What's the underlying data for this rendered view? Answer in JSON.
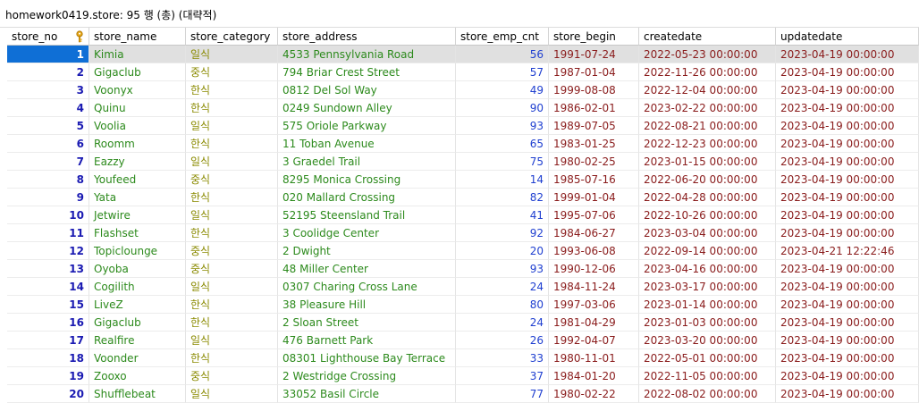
{
  "title": "homework0419.store: 95 행 (총) (대략적)",
  "columns": [
    "store_no",
    "store_name",
    "store_category",
    "store_address",
    "store_emp_cnt",
    "store_begin",
    "createdate",
    "updatedate"
  ],
  "icons": {
    "primary_key": "key-icon"
  },
  "colors": {
    "selected_row": "#e0e0e0",
    "selected_cell": "#0f6fd6",
    "number": "#1f3fd0",
    "text": "#2c8a1c",
    "date": "#8a1c1c"
  },
  "rows": [
    [
      "1",
      "Kimia",
      "일식",
      "4533 Pennsylvania Road",
      "56",
      "1991-07-24",
      "2022-05-23 00:00:00",
      "2023-04-19 00:00:00"
    ],
    [
      "2",
      "Gigaclub",
      "중식",
      "794 Briar Crest Street",
      "57",
      "1987-01-04",
      "2022-11-26 00:00:00",
      "2023-04-19 00:00:00"
    ],
    [
      "3",
      "Voonyx",
      "한식",
      "0812 Del Sol Way",
      "49",
      "1999-08-08",
      "2022-12-04 00:00:00",
      "2023-04-19 00:00:00"
    ],
    [
      "4",
      "Quinu",
      "한식",
      "0249 Sundown Alley",
      "90",
      "1986-02-01",
      "2023-02-22 00:00:00",
      "2023-04-19 00:00:00"
    ],
    [
      "5",
      "Voolia",
      "일식",
      "575 Oriole Parkway",
      "93",
      "1989-07-05",
      "2022-08-21 00:00:00",
      "2023-04-19 00:00:00"
    ],
    [
      "6",
      "Roomm",
      "한식",
      "11 Toban Avenue",
      "65",
      "1983-01-25",
      "2022-12-23 00:00:00",
      "2023-04-19 00:00:00"
    ],
    [
      "7",
      "Eazzy",
      "일식",
      "3 Graedel Trail",
      "75",
      "1980-02-25",
      "2023-01-15 00:00:00",
      "2023-04-19 00:00:00"
    ],
    [
      "8",
      "Youfeed",
      "중식",
      "8295 Monica Crossing",
      "14",
      "1985-07-16",
      "2022-06-20 00:00:00",
      "2023-04-19 00:00:00"
    ],
    [
      "9",
      "Yata",
      "한식",
      "020 Mallard Crossing",
      "82",
      "1999-01-04",
      "2022-04-28 00:00:00",
      "2023-04-19 00:00:00"
    ],
    [
      "10",
      "Jetwire",
      "일식",
      "52195 Steensland Trail",
      "41",
      "1995-07-06",
      "2022-10-26 00:00:00",
      "2023-04-19 00:00:00"
    ],
    [
      "11",
      "Flashset",
      "한식",
      "3 Coolidge Center",
      "92",
      "1984-06-27",
      "2023-03-04 00:00:00",
      "2023-04-19 00:00:00"
    ],
    [
      "12",
      "Topiclounge",
      "중식",
      "2 Dwight",
      "20",
      "1993-06-08",
      "2022-09-14 00:00:00",
      "2023-04-21 12:22:46"
    ],
    [
      "13",
      "Oyoba",
      "중식",
      "48 Miller Center",
      "93",
      "1990-12-06",
      "2023-04-16 00:00:00",
      "2023-04-19 00:00:00"
    ],
    [
      "14",
      "Cogilith",
      "일식",
      "0307 Charing Cross Lane",
      "24",
      "1984-11-24",
      "2023-03-17 00:00:00",
      "2023-04-19 00:00:00"
    ],
    [
      "15",
      "LiveZ",
      "한식",
      "38 Pleasure Hill",
      "80",
      "1997-03-06",
      "2023-01-14 00:00:00",
      "2023-04-19 00:00:00"
    ],
    [
      "16",
      "Gigaclub",
      "한식",
      "2 Sloan Street",
      "24",
      "1981-04-29",
      "2023-01-03 00:00:00",
      "2023-04-19 00:00:00"
    ],
    [
      "17",
      "Realfire",
      "일식",
      "476 Barnett Park",
      "26",
      "1992-04-07",
      "2023-03-20 00:00:00",
      "2023-04-19 00:00:00"
    ],
    [
      "18",
      "Voonder",
      "한식",
      "08301 Lighthouse Bay Terrace",
      "33",
      "1980-11-01",
      "2022-05-01 00:00:00",
      "2023-04-19 00:00:00"
    ],
    [
      "19",
      "Zooxo",
      "중식",
      "2 Westridge Crossing",
      "37",
      "1984-01-20",
      "2022-11-05 00:00:00",
      "2023-04-19 00:00:00"
    ],
    [
      "20",
      "Shufflebeat",
      "일식",
      "33052 Basil Circle",
      "77",
      "1980-02-22",
      "2022-08-02 00:00:00",
      "2023-04-19 00:00:00"
    ]
  ]
}
